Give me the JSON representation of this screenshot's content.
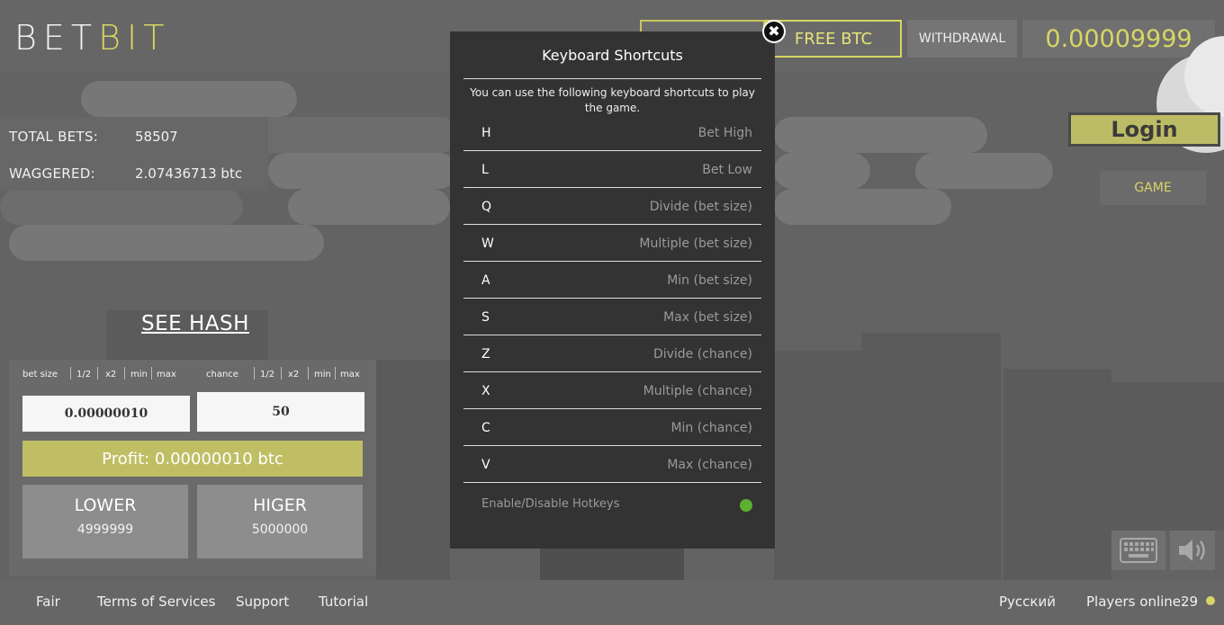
{
  "header": {
    "logo_left": "BET",
    "logo_right": "BIT",
    "free_btc": "FREE BTC",
    "withdrawal": "WITHDRAWAL",
    "balance": "0.00009999"
  },
  "stats": {
    "total_bets_label": "TOTAL BETS:",
    "total_bets_value": "58507",
    "waggered_label": "WAGGERED:",
    "waggered_value": "2.07436713 btc"
  },
  "see_hash": "SEE HASH",
  "bet": {
    "bet_size_label": "bet size",
    "chance_label": "chance",
    "half": "1/2",
    "double": "x2",
    "min": "min",
    "max": "max",
    "bet_size_value": "0.00000010",
    "chance_value": "50",
    "profit": "Profit: 0.00000010 btc",
    "lower_label": "LOWER",
    "lower_value": "4999999",
    "higher_label": "HIGER",
    "higher_value": "5000000"
  },
  "right": {
    "login": "Login",
    "game": "GAME"
  },
  "modal": {
    "title": "Keyboard Shortcuts",
    "description": "You can use the following keyboard shortcuts to play the game.",
    "shortcuts": [
      {
        "key": "H",
        "action": "Bet High"
      },
      {
        "key": "L",
        "action": "Bet Low"
      },
      {
        "key": "Q",
        "action": "Divide (bet size)"
      },
      {
        "key": "W",
        "action": "Multiple (bet size)"
      },
      {
        "key": "A",
        "action": "Min (bet size)"
      },
      {
        "key": "S",
        "action": "Max (bet size)"
      },
      {
        "key": "Z",
        "action": "Divide (chance)"
      },
      {
        "key": "X",
        "action": "Multiple (chance)"
      },
      {
        "key": "C",
        "action": "Min (chance)"
      },
      {
        "key": "V",
        "action": "Max (chance)"
      }
    ],
    "hotkeys_label": "Enable/Disable Hotkeys",
    "hotkeys_color": "#5cb130"
  },
  "footer": {
    "fair": "Fair",
    "terms": "Terms of Services",
    "support": "Support",
    "tutorial": "Tutorial",
    "language": "Русский",
    "players_online_label": "Players online:",
    "players_online_value": "29"
  },
  "colors": {
    "accent": "#d7d665",
    "background": "#636363",
    "modal": "#333333"
  }
}
